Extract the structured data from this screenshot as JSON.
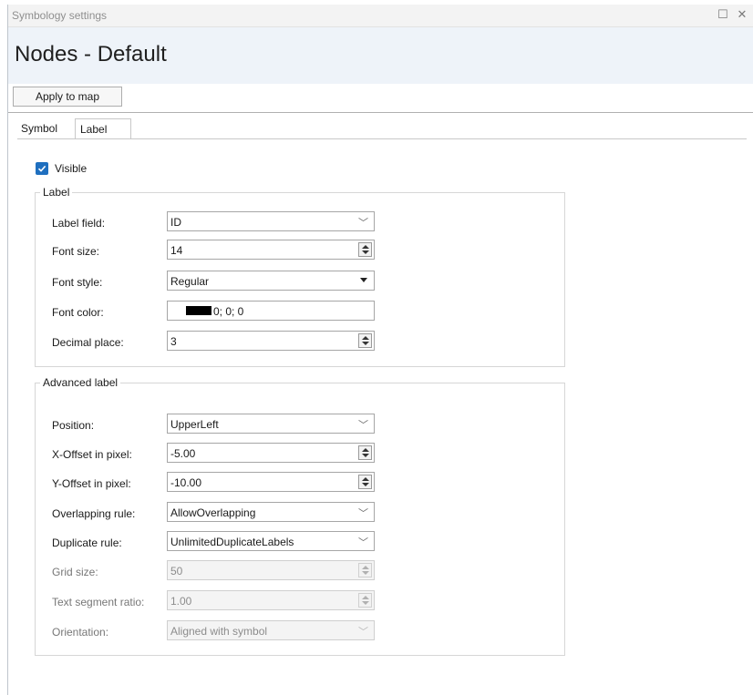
{
  "window": {
    "title": "Symbology settings",
    "restore_glyph": "☐",
    "close_glyph": "✕"
  },
  "header": {
    "title": "Nodes - Default"
  },
  "toolbar": {
    "apply_label": "Apply to map"
  },
  "tabs": [
    {
      "label": "Symbol",
      "active": false
    },
    {
      "label": "Label",
      "active": true
    }
  ],
  "visible": {
    "label": "Visible",
    "checked": true
  },
  "label_group": {
    "legend": "Label",
    "label_field": {
      "label": "Label field:",
      "value": "ID"
    },
    "font_size": {
      "label": "Font size:",
      "value": "14"
    },
    "font_style": {
      "label": "Font style:",
      "value": "Regular"
    },
    "font_color": {
      "label": "Font color:",
      "value": "0; 0; 0",
      "swatch": "#000000"
    },
    "decimal_place": {
      "label": "Decimal place:",
      "value": "3"
    }
  },
  "advanced_group": {
    "legend": "Advanced label",
    "position": {
      "label": "Position:",
      "value": "UpperLeft"
    },
    "x_offset": {
      "label": "X-Offset in pixel:",
      "value": "-5.00"
    },
    "y_offset": {
      "label": "Y-Offset in pixel:",
      "value": "-10.00"
    },
    "overlapping": {
      "label": "Overlapping rule:",
      "value": "AllowOverlapping"
    },
    "duplicate": {
      "label": "Duplicate rule:",
      "value": "UnlimitedDuplicateLabels"
    },
    "grid_size": {
      "label": "Grid size:",
      "value": "50",
      "enabled": false
    },
    "text_segment": {
      "label": "Text segment ratio:",
      "value": "1.00",
      "enabled": false
    },
    "orientation": {
      "label": "Orientation:",
      "value": "Aligned with symbol",
      "enabled": false
    }
  },
  "colors": {
    "accent": "#1f6fbf",
    "header_bg": "#eef3f9"
  }
}
